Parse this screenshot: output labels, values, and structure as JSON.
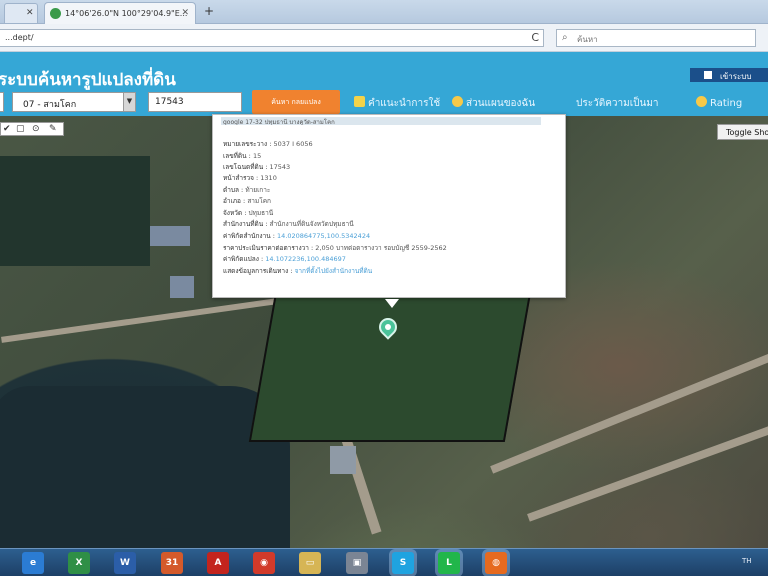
{
  "browser": {
    "tabs": [
      {
        "label": "",
        "glyph": "✕"
      },
      {
        "label": "14°06'26.0\"N 100°29'04.9\"E...",
        "close": "✕"
      }
    ],
    "new_tab": "+",
    "address": "...dept/",
    "refresh_glyph": "C",
    "search_placeholder": "ค้นหา"
  },
  "app": {
    "title": "ระบบค้นหารูปแปลงที่ดิน",
    "login_label": "เข้าระบบ",
    "district_select": "07 - สามโคก",
    "parcel_number": "17543",
    "search_button": "ค้นหา กลยแปลง",
    "menu": [
      {
        "label": "คำแนะนำการใช้",
        "icon": "book-icon",
        "color": "#f3d34a"
      },
      {
        "label": "ส่วนแผนของฉัน",
        "icon": "smiley-icon",
        "color": "#f7c948"
      },
      {
        "label": "ประวัติความเป็นมา",
        "icon": "history-icon",
        "color": ""
      },
      {
        "label": "Rating",
        "icon": "star-icon",
        "color": "#f7c948"
      }
    ]
  },
  "map": {
    "tools": [
      "✔",
      "▢",
      "⊙",
      "✎"
    ],
    "toggle_button": "Toggle Sho"
  },
  "popup": {
    "header": "google 17-32 ปทุมธานี บางคูวัด-สามโคก",
    "rows": [
      {
        "label": "หมายเลขระวาง :",
        "value": "5037 I 6056"
      },
      {
        "label": "เลขที่ดิน :",
        "value": "15"
      },
      {
        "label": "เลขโฉนดที่ดิน :",
        "value": "17543"
      },
      {
        "label": "หน้าสำรวจ :",
        "value": "1310"
      },
      {
        "label": "ตำบล :",
        "value": "ท้ายเกาะ"
      },
      {
        "label": "อำเภอ :",
        "value": "สามโคก"
      },
      {
        "label": "จังหวัด :",
        "value": "ปทุมธานี"
      },
      {
        "label": "สำนักงานที่ดิน :",
        "value": "สำนักงานที่ดินจังหวัดปทุมธานี"
      },
      {
        "label": "ค่าพิกัดสำนักงาน :",
        "value": "14.020864775,100.5342424"
      },
      {
        "label": "ราคาประเมินราคาต่อตารางวา :",
        "value": "2,050 บาทต่อตารางวา รอบบัญชี 2559-2562"
      },
      {
        "label": "ค่าพิกัดแปลง :",
        "value": "14.1072236,100.484697"
      },
      {
        "label": "แสดงข้อมูลการเดินทาง :",
        "value": "จากที่ตั้งไปยังสำนักงานที่ดิน"
      }
    ]
  },
  "taskbar": {
    "icons": [
      {
        "name": "ie-icon",
        "glyph": "e",
        "color": "#2b7cd3"
      },
      {
        "name": "excel-icon",
        "glyph": "X",
        "color": "#2f8f46"
      },
      {
        "name": "word-icon",
        "glyph": "W",
        "color": "#2b5ea8"
      },
      {
        "name": "calendar-icon",
        "glyph": "31",
        "color": "#d45a2b"
      },
      {
        "name": "acrobat-icon",
        "glyph": "A",
        "color": "#c3241d"
      },
      {
        "name": "app-red-icon",
        "glyph": "◉",
        "color": "#d23a2a"
      },
      {
        "name": "folder-icon",
        "glyph": "▭",
        "color": "#d6b555"
      },
      {
        "name": "tool-icon",
        "glyph": "▣",
        "color": "#7b8594"
      },
      {
        "name": "skype-icon",
        "glyph": "S",
        "color": "#1fa3e0"
      },
      {
        "name": "line-icon",
        "glyph": "L",
        "color": "#21b64a"
      },
      {
        "name": "firefox-icon",
        "glyph": "◍",
        "color": "#e66a1f"
      }
    ],
    "tray_text": "TH"
  }
}
